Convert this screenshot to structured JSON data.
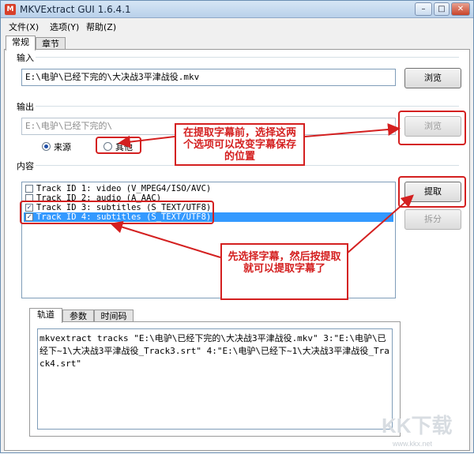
{
  "window": {
    "title": "MKVExtract GUI 1.6.4.1",
    "minimize": "–",
    "maximize": "□",
    "close": "✕"
  },
  "menu": [
    "文件(X)",
    "选项(Y)",
    "帮助(Z)"
  ],
  "tabs": [
    "常规",
    "章节"
  ],
  "input_section": {
    "label": "输入",
    "path": "E:\\电驴\\已经下完的\\大决战3平津战役.mkv",
    "browse": "浏览"
  },
  "output_section": {
    "label": "输出",
    "path": "E:\\电驴\\已经下完的\\",
    "browse": "浏览",
    "radio_source": "来源",
    "radio_other": "其他"
  },
  "content_section": {
    "label": "内容",
    "tracks": [
      {
        "checked": false,
        "text": "Track ID 1: video (V_MPEG4/ISO/AVC)"
      },
      {
        "checked": false,
        "text": "Track ID 2: audio (A_AAC)"
      },
      {
        "checked": true,
        "text": "Track ID 3: subtitles (S_TEXT/UTF8)"
      },
      {
        "checked": true,
        "text": "Track ID 4: subtitles (S_TEXT/UTF8)"
      }
    ],
    "extract": "提取",
    "split": "拆分"
  },
  "subtabs": [
    "轨道",
    "参数",
    "时间码"
  ],
  "command": "mkvextract tracks \"E:\\电驴\\已经下完的\\大决战3平津战役.mkv\" 3:\"E:\\电驴\\已经下~1\\大决战3平津战役_Track3.srt\" 4:\"E:\\电驴\\已经下~1\\大决战3平津战役_Track4.srt\"",
  "annotations": {
    "callout_top": "在提取字幕前，选择这两个选项可以改变字幕保存的位置",
    "callout_bottom": "先选择字幕，然后按提取就可以提取字幕了"
  },
  "watermark": {
    "text": "KK下载",
    "url": "www.kkx.net"
  },
  "colors": {
    "accent_red": "#d42020",
    "selection": "#3399ff"
  }
}
